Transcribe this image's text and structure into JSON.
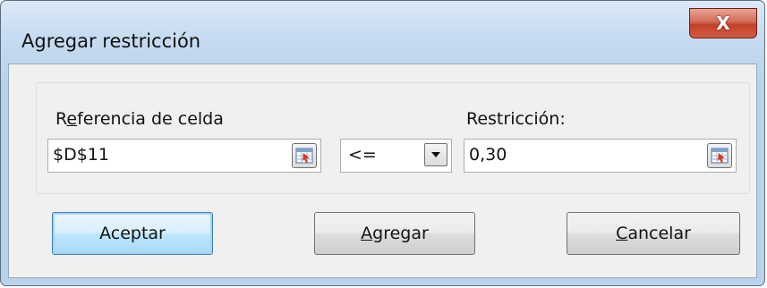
{
  "window": {
    "title": "Agregar restricción",
    "close_label": "X"
  },
  "form": {
    "cell_ref_label_prefix": "R",
    "cell_ref_label_accel": "e",
    "cell_ref_label_rest": "ferencia de celda",
    "cell_ref_value": "$D$11",
    "operator_value": "<=",
    "constraint_label": "Restricción:",
    "constraint_value": "0,30"
  },
  "buttons": {
    "ok_label": "Aceptar",
    "add_accel": "A",
    "add_rest": "gregar",
    "cancel_accel": "C",
    "cancel_rest": "ancelar"
  },
  "icons": {
    "cell_ref_picker": "range-select-icon",
    "constraint_picker": "range-select-icon",
    "operator_dropdown": "chevron-down-icon"
  },
  "colors": {
    "title_bar": "#c7dcf1",
    "close_button": "#c2412a",
    "client_background": "#f0f0f0",
    "default_button": "#bee6fd"
  }
}
